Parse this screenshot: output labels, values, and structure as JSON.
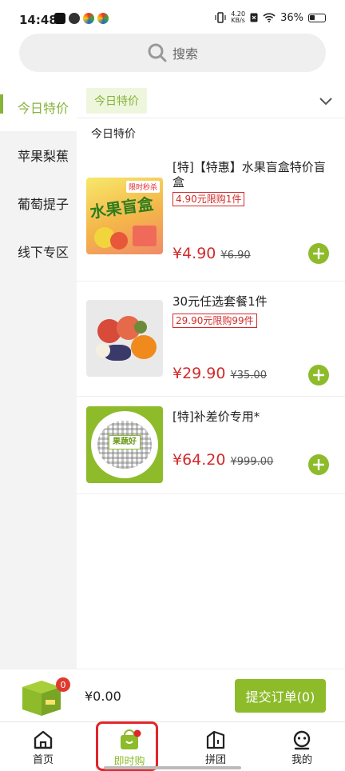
{
  "status_bar": {
    "time": "14:48",
    "net_speed_value": "4.20",
    "net_speed_unit": "KB/s",
    "battery": "36%"
  },
  "search": {
    "placeholder": "搜索"
  },
  "sidebar": {
    "items": [
      {
        "label": "今日特价",
        "active": true
      },
      {
        "label": "苹果梨蕉",
        "active": false
      },
      {
        "label": "葡萄提子",
        "active": false
      },
      {
        "label": "线下专区",
        "active": false
      }
    ]
  },
  "content": {
    "chip_label": "今日特价",
    "section_title": "今日特价",
    "products": [
      {
        "name": "[特]【特惠】水果盲盒特价盲盒",
        "limit": "4.90元限购1件",
        "price": "¥4.90",
        "old_price": "¥6.90",
        "image_icon": "fruit-blind-box-image",
        "image_text_1": "限时秒杀",
        "image_text_2": "水果盲盒"
      },
      {
        "name": "30元任选套餐1件",
        "limit": "29.90元限购99件",
        "price": "¥29.90",
        "old_price": "¥35.00",
        "image_icon": "fruit-combo-image"
      },
      {
        "name": "[特]补差价专用*",
        "limit": "",
        "price": "¥64.20",
        "old_price": "¥999.00",
        "image_icon": "qr-code-image",
        "image_text_1": "果蔬好"
      }
    ]
  },
  "cart": {
    "badge": "0",
    "total": "¥0.00",
    "submit_label": "提交订单(0)"
  },
  "tabbar": {
    "tabs": [
      {
        "label": "首页",
        "icon": "home-icon"
      },
      {
        "label": "即时购",
        "icon": "bag-icon",
        "active": true
      },
      {
        "label": "拼团",
        "icon": "group-icon"
      },
      {
        "label": "我的",
        "icon": "profile-icon"
      }
    ]
  },
  "colors": {
    "accent_green": "#8dbb2a",
    "price_red": "#d22b2b",
    "highlight_red": "#e0262b"
  }
}
